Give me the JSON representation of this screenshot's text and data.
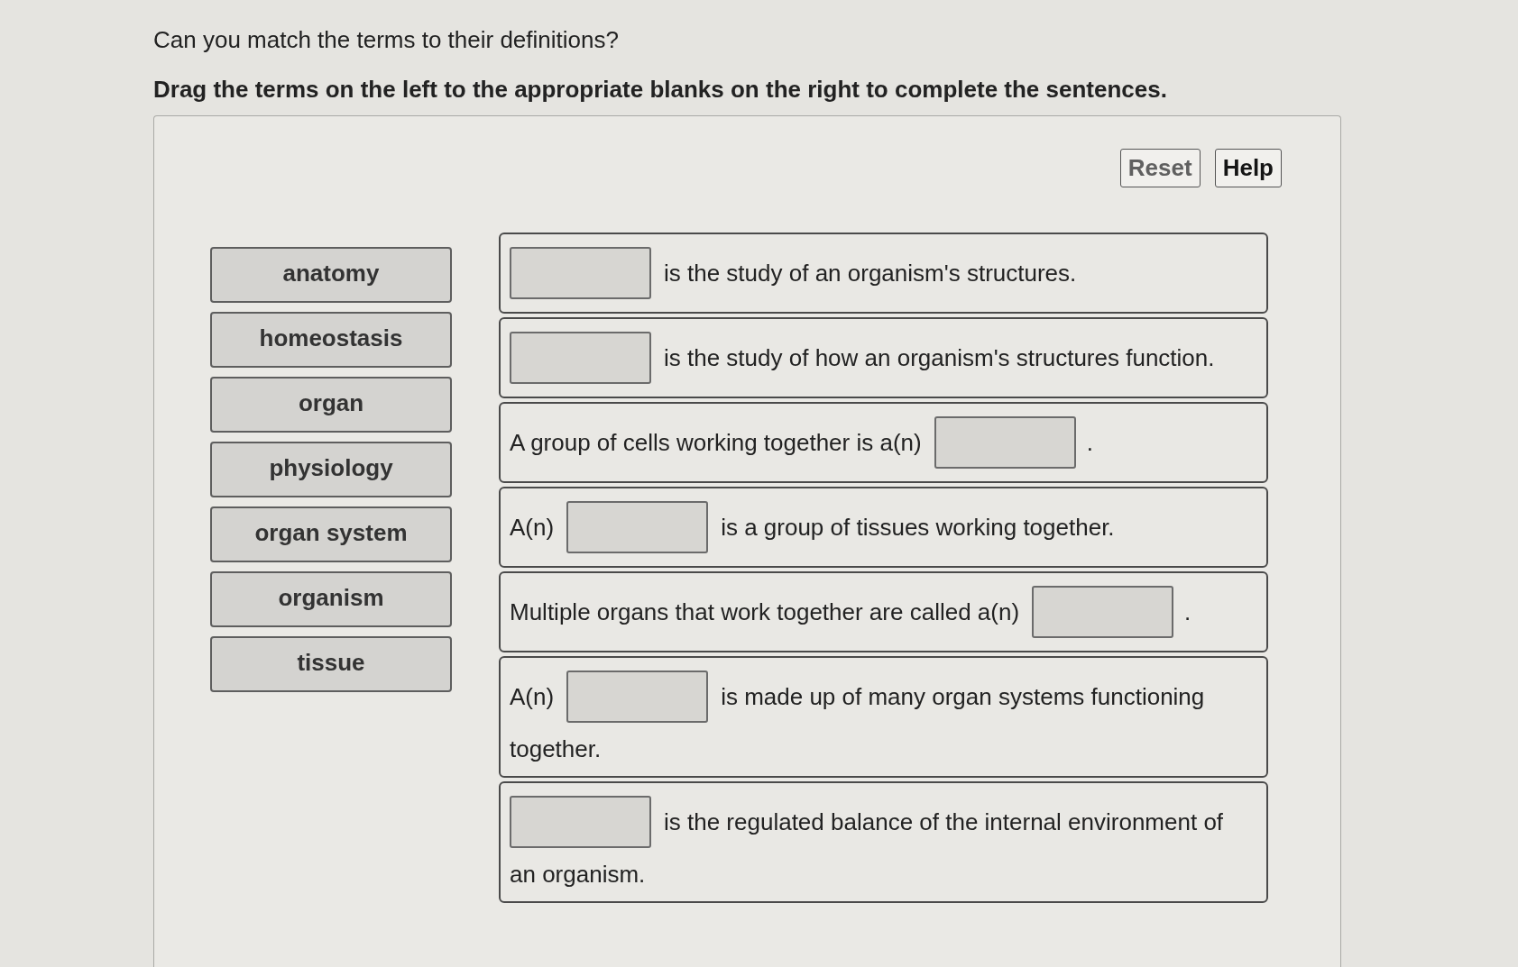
{
  "question": "Can you match the terms to their definitions?",
  "instruction": "Drag the terms on the left to the appropriate blanks on the right to complete the sentences.",
  "buttons": [
    {
      "label": "Reset",
      "disabled": true
    },
    {
      "label": "Help",
      "disabled": false
    }
  ],
  "terms": [
    "anatomy",
    "homeostasis",
    "organ",
    "physiology",
    "organ system",
    "organism",
    "tissue"
  ],
  "sentences": [
    {
      "parts": [
        {
          "kind": "blank"
        },
        {
          "kind": "text",
          "text": "is the study of an organism's structures."
        }
      ]
    },
    {
      "parts": [
        {
          "kind": "blank"
        },
        {
          "kind": "text",
          "text": "is the study of how an organism's structures function."
        }
      ]
    },
    {
      "parts": [
        {
          "kind": "text",
          "text": "A group of cells working together is a(n)"
        },
        {
          "kind": "blank"
        },
        {
          "kind": "text",
          "text": "."
        }
      ]
    },
    {
      "parts": [
        {
          "kind": "text",
          "text": "A(n)"
        },
        {
          "kind": "blank"
        },
        {
          "kind": "text",
          "text": "is a group of tissues working together."
        }
      ]
    },
    {
      "parts": [
        {
          "kind": "text",
          "text": "Multiple organs that work together are called a(n)"
        },
        {
          "kind": "blank"
        },
        {
          "kind": "text",
          "text": "."
        }
      ]
    },
    {
      "parts": [
        {
          "kind": "text",
          "text": "A(n)"
        },
        {
          "kind": "blank"
        },
        {
          "kind": "text",
          "text": "is made up of many organ systems functioning"
        },
        {
          "kind": "text",
          "text": "together."
        }
      ]
    },
    {
      "parts": [
        {
          "kind": "blank"
        },
        {
          "kind": "text",
          "text": "is the regulated balance of the internal environment of"
        },
        {
          "kind": "text",
          "text": "an organism."
        }
      ]
    }
  ]
}
